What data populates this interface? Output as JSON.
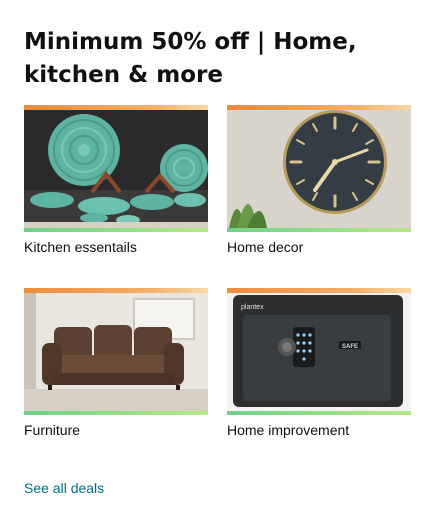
{
  "card": {
    "title": "Minimum 50% off | Home, kitchen & more",
    "tiles": [
      {
        "label": "Kitchen essentails",
        "image_icon": "dinnerware-set-icon"
      },
      {
        "label": "Home decor",
        "image_icon": "wall-clock-icon"
      },
      {
        "label": "Furniture",
        "image_icon": "sofa-icon"
      },
      {
        "label": "Home improvement",
        "image_icon": "safe-icon",
        "brand_text": "plantex",
        "safe_text": "SAFE"
      }
    ],
    "see_all_label": "See all deals"
  },
  "colors": {
    "title": "#0f1111",
    "link": "#007185",
    "accent_orange": "#f08a3a",
    "accent_green": "#7fdc6a"
  }
}
